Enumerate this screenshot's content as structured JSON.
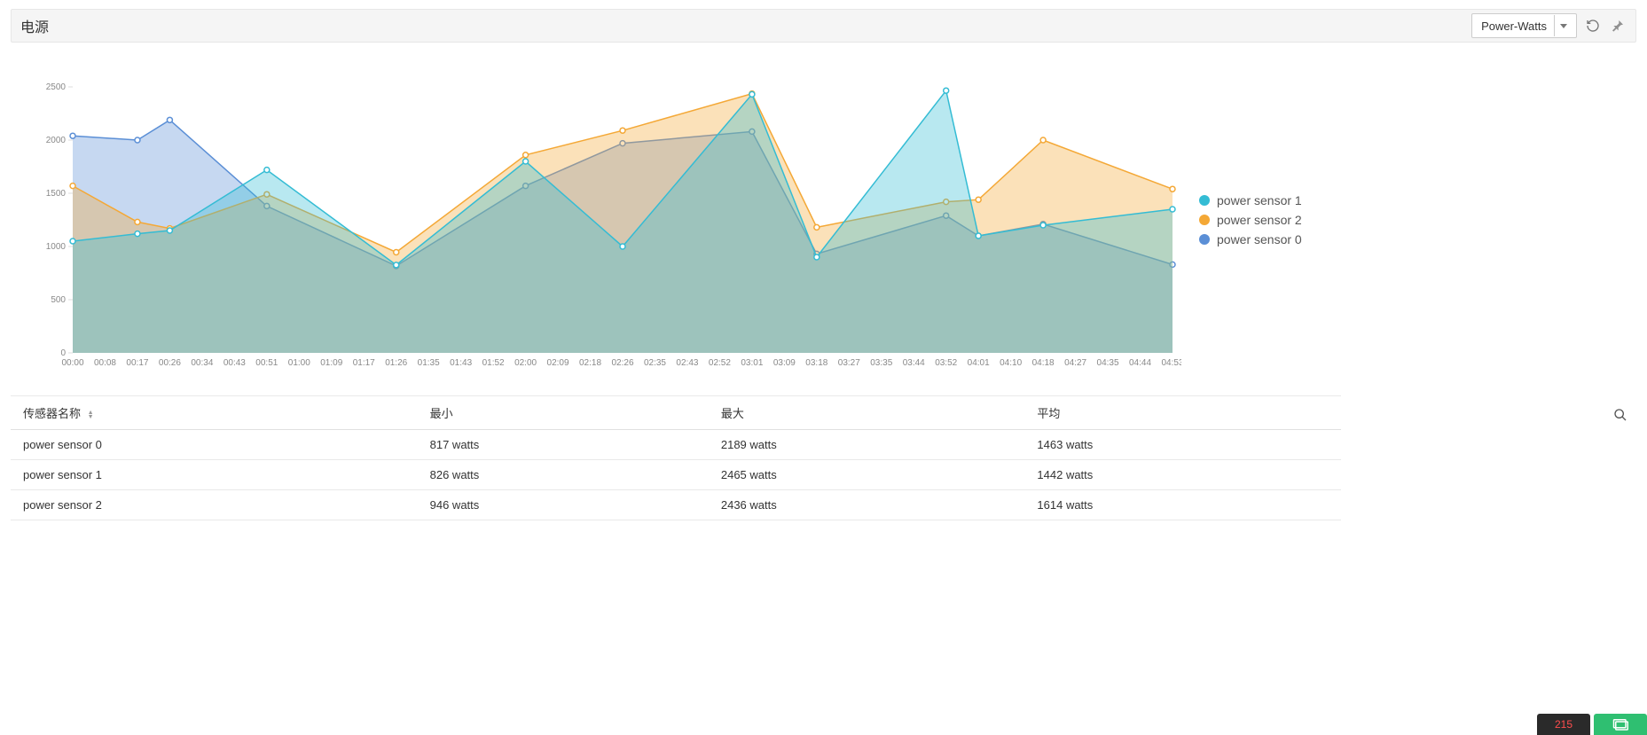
{
  "header": {
    "title": "电源",
    "dropdown_label": "Power-Watts"
  },
  "chart_data": {
    "type": "area",
    "title": "",
    "xlabel": "",
    "ylabel": "",
    "ylim": [
      0,
      2500
    ],
    "categories": [
      "00:00",
      "00:08",
      "00:17",
      "00:26",
      "00:34",
      "00:43",
      "00:51",
      "01:00",
      "01:09",
      "01:17",
      "01:26",
      "01:35",
      "01:43",
      "01:52",
      "02:00",
      "02:09",
      "02:18",
      "02:26",
      "02:35",
      "02:43",
      "02:52",
      "03:01",
      "03:09",
      "03:18",
      "03:27",
      "03:35",
      "03:44",
      "03:52",
      "04:01",
      "04:10",
      "04:18",
      "04:27",
      "04:35",
      "04:44",
      "04:53"
    ],
    "x": [
      0,
      2,
      3,
      6,
      10,
      14,
      17,
      21,
      23,
      27,
      28,
      30,
      34
    ],
    "series": [
      {
        "name": "power sensor 1",
        "color": "#34bcd4",
        "values": [
          1050,
          1120,
          1150,
          1720,
          826,
          1800,
          1000,
          2430,
          900,
          2465,
          1100,
          1200,
          1350
        ]
      },
      {
        "name": "power sensor 2",
        "color": "#f4a836",
        "values": [
          1570,
          1230,
          1170,
          1490,
          946,
          1860,
          2090,
          2436,
          1180,
          1420,
          1440,
          2000,
          1540
        ]
      },
      {
        "name": "power sensor 0",
        "color": "#5b8fd6",
        "values": [
          2040,
          2000,
          2189,
          1380,
          817,
          1570,
          1970,
          2080,
          930,
          1290,
          1100,
          1210,
          830
        ]
      }
    ]
  },
  "legend": [
    {
      "name": "power sensor 1",
      "color": "#34bcd4"
    },
    {
      "name": "power sensor 2",
      "color": "#f4a836"
    },
    {
      "name": "power sensor 0",
      "color": "#5b8fd6"
    }
  ],
  "table": {
    "headers": {
      "name": "传感器名称",
      "min": "最小",
      "max": "最大",
      "avg": "平均"
    },
    "rows": [
      {
        "name": "power sensor 0",
        "min": "817 watts",
        "max": "2189 watts",
        "avg": "1463 watts"
      },
      {
        "name": "power sensor 1",
        "min": "826 watts",
        "max": "2465 watts",
        "avg": "1442 watts"
      },
      {
        "name": "power sensor 2",
        "min": "946 watts",
        "max": "2436 watts",
        "avg": "1614 watts"
      }
    ]
  },
  "dock": {
    "count": "215"
  }
}
